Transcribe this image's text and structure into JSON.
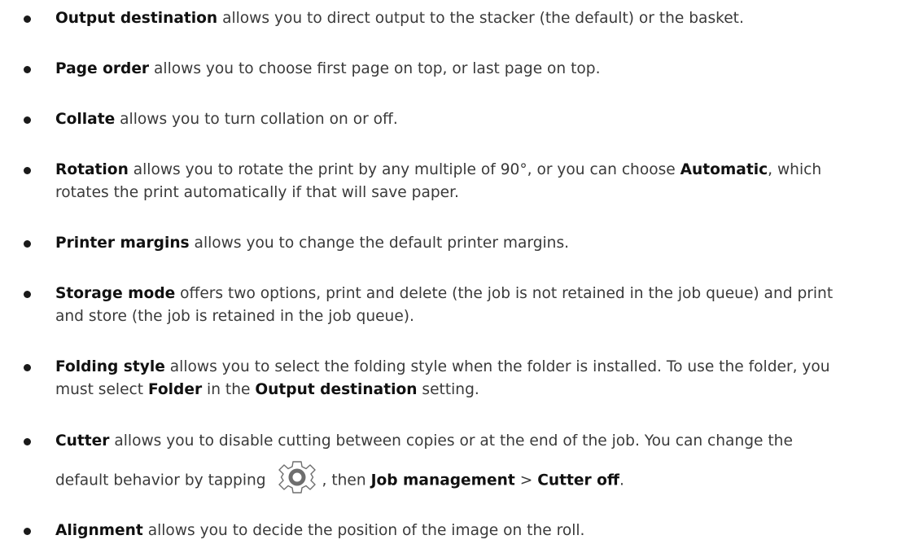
{
  "items": [
    {
      "term": "Output destination",
      "rest": " allows you to direct output to the stacker (the default) or the basket."
    },
    {
      "term": "Page order",
      "rest": " allows you to choose first page on top, or last page on top."
    },
    {
      "term": "Collate",
      "rest": " allows you to turn collation on or off."
    },
    {
      "term": "Rotation",
      "rest1": " allows you to rotate the print by any multiple of 90°, or you can choose ",
      "term2": "Automatic",
      "rest2": ", which",
      "line2": "rotates the print automatically if that will save paper."
    },
    {
      "term": "Printer margins",
      "rest": " allows you to change the default printer margins."
    },
    {
      "term": "Storage mode",
      "rest1": " offers two options, print and delete (the job is not retained in the job queue) and print",
      "line2": "and store (the job is retained in the job queue)."
    },
    {
      "term": "Folding style",
      "rest1": " allows you to select the folding style when the folder is installed. To use the folder, you",
      "line2a": "must select ",
      "term2": "Folder",
      "line2b": " in the ",
      "term3": "Output destination",
      "line2c": " setting."
    },
    {
      "term": "Cutter",
      "rest1": " allows you to disable cutting between copies or at the end of the job. You can change the",
      "line2a": "default behavior by tapping ",
      "icon": "settings-gear-icon",
      "line2b": ", then ",
      "term2": "Job management",
      "sep": " > ",
      "term3": "Cutter off",
      "end": "."
    },
    {
      "term": "Alignment",
      "rest": " allows you to decide the position of the image on the roll."
    }
  ]
}
